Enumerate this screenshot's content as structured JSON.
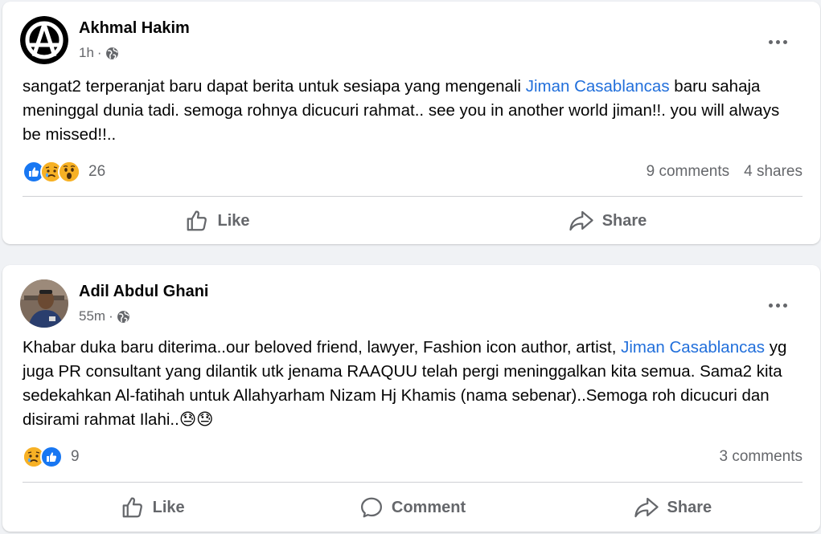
{
  "posts": [
    {
      "author": "Akhmal Hakim",
      "time": "1h",
      "dot": "·",
      "text_before": "sangat2 terperanjat baru dapat berita untuk sesiapa yang mengenali ",
      "link": "Jiman Casablancas",
      "text_after": " baru sahaja meninggal dunia tadi. semoga rohnya dicucuri rahmat.. see you in another world jiman!!. you will always be missed!!..",
      "reaction_icons": [
        "like-icon",
        "sad-icon",
        "wow-icon"
      ],
      "reaction_count": "26",
      "comments": "9 comments",
      "shares": "4 shares",
      "actions": {
        "like": "Like",
        "share": "Share"
      }
    },
    {
      "author": "Adil Abdul Ghani",
      "time": "55m",
      "dot": "·",
      "text_before": "Khabar duka baru diterima..our beloved friend, lawyer, Fashion icon author, artist, ",
      "link": "Jiman Casablancas",
      "text_after": " yg juga PR consultant  yang dilantik utk jenama RAAQUU telah pergi meninggalkan kita semua. Sama2 kita sedekahkan Al-fatihah untuk Allahyarham Nizam Hj Khamis (nama sebenar)..Semoga roh dicucuri dan disirami rahmat Ilahi..",
      "text_emoji": "😓😓",
      "reaction_icons": [
        "sad-icon",
        "like-icon"
      ],
      "reaction_count": "9",
      "comments": "3 comments",
      "actions": {
        "like": "Like",
        "comment": "Comment",
        "share": "Share"
      }
    }
  ],
  "colors": {
    "link": "#216fdb",
    "secondary_text": "#65676b",
    "like_blue": "#1877f2",
    "emoji_yellow": "#f7b125",
    "background": "#f0f2f5"
  }
}
